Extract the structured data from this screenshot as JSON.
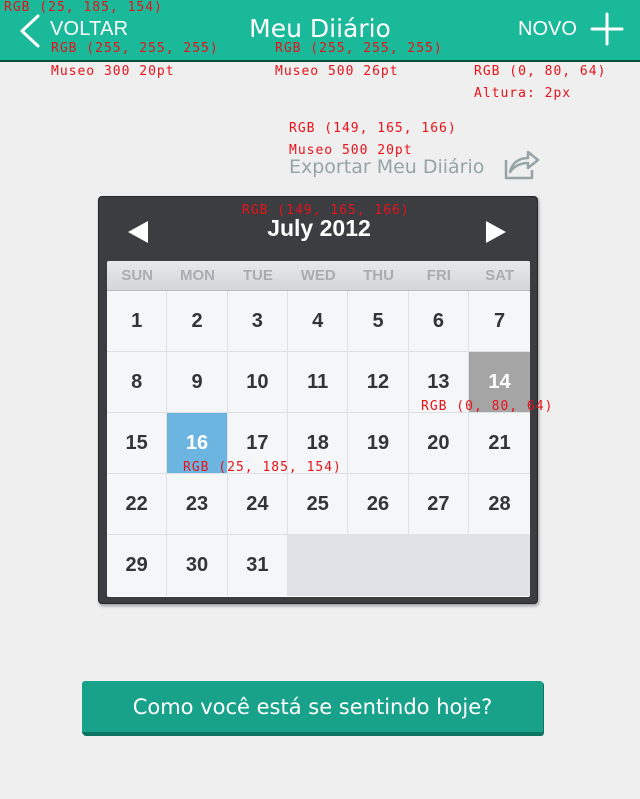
{
  "header": {
    "back_label": "VOLTAR",
    "title": "Meu Diiário",
    "new_label": "NOVO",
    "background_color": "#19b99a",
    "line_color": "#005040"
  },
  "annotations": {
    "header_bg": "RGB (25, 185, 154)",
    "back_color": "RGB (255, 255, 255)",
    "back_font": "Museo 300 20pt",
    "title_color": "RGB (255, 255, 255)",
    "title_font": "Museo 500 26pt",
    "line_color": "RGB (0, 80, 64)",
    "line_height": "Altura: 2px",
    "export_color": "RGB (149, 165, 166)",
    "export_font": "Museo 500 20pt",
    "calendar_header": "RGB (149, 165, 166)",
    "today_color": "RGB (0, 80, 64)",
    "selected_color": "RGB (25, 185, 154)"
  },
  "export": {
    "label": "Exportar Meu Diiário",
    "icon": "share-icon",
    "color": "#95a5a6"
  },
  "calendar": {
    "month_label": "July 2012",
    "weekdays": [
      "SUN",
      "MON",
      "TUE",
      "WED",
      "THU",
      "FRI",
      "SAT"
    ],
    "weeks": [
      [
        "1",
        "2",
        "3",
        "4",
        "5",
        "6",
        "7"
      ],
      [
        "8",
        "9",
        "10",
        "11",
        "12",
        "13",
        "14"
      ],
      [
        "15",
        "16",
        "17",
        "18",
        "19",
        "20",
        "21"
      ],
      [
        "22",
        "23",
        "24",
        "25",
        "26",
        "27",
        "28"
      ],
      [
        "29",
        "30",
        "31",
        "",
        "",
        "",
        ""
      ]
    ],
    "today": "14",
    "selected": "16",
    "prev_icon": "arrow-left-icon",
    "next_icon": "arrow-right-icon"
  },
  "mood_button": {
    "label": "Como você está se sentindo hoje?"
  }
}
